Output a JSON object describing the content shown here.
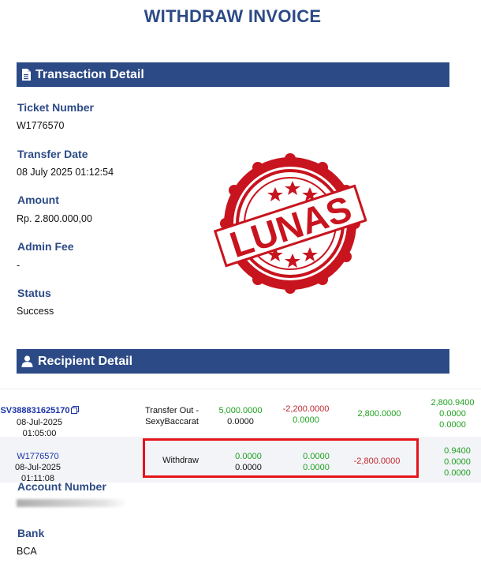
{
  "header": {
    "title": "WITHDRAW INVOICE"
  },
  "transaction": {
    "section_title": "Transaction Detail",
    "ticket_label": "Ticket Number",
    "ticket_value": "W1776570",
    "date_label": "Transfer Date",
    "date_value": "08 July 2025 01:12:54",
    "amount_label": "Amount",
    "amount_value": "Rp. 2.800.000,00",
    "fee_label": "Admin Fee",
    "fee_value": "-",
    "status_label": "Status",
    "status_value": "Success"
  },
  "stamp": {
    "text": "LUNAS",
    "color": "#c8141e"
  },
  "recipient": {
    "section_title": "Recipient Detail",
    "rows": [
      {
        "id": "SV388831625170",
        "datetime": "08-Jul-2025 01:05:00",
        "type_line1": "Transfer Out -",
        "type_line2": "SexyBaccarat",
        "c1_top": "5,000.0000",
        "c1_bottom": "0.0000",
        "c2_top": "-2,200.0000",
        "c2_bottom": "0.0000",
        "c3": "2,800.0000",
        "c4_top": "2,800.9400",
        "c4_mid": "0.0000",
        "c4_bottom": "0.0000"
      },
      {
        "id": "W1776570",
        "datetime": "08-Jul-2025 01:11:08",
        "type_line1": "Withdraw",
        "c1_top": "0.0000",
        "c1_bottom": "0.0000",
        "c2_top": "0.0000",
        "c2_bottom": "0.0000",
        "c3": "-2,800.0000",
        "c4_top": "0.9400",
        "c4_mid": "0.0000",
        "c4_bottom": "0.0000"
      }
    ],
    "account_label": "Account Number",
    "bank_label": "Bank",
    "bank_value": "BCA"
  },
  "colors": {
    "brand": "#2c4a86",
    "positive": "#1fa01f",
    "negative": "#c0262d",
    "highlight": "#e5141b"
  }
}
